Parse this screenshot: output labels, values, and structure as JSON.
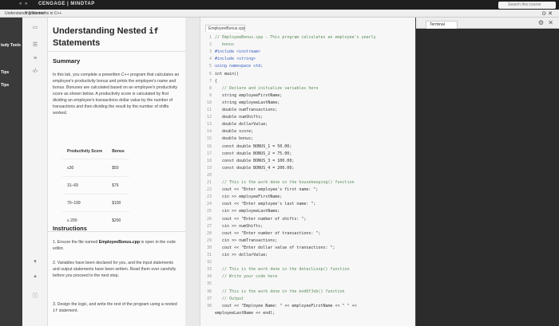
{
  "topbar": {
    "nav": "«  »",
    "brand": "CENGAGE | MINDTAP",
    "search": "Search this course"
  },
  "subbar": {
    "crumb": "Understanding Nested",
    "crumb2": "if Statements in C++"
  },
  "leftnav": [
    "tudy Tools",
    "Tips",
    "Tips"
  ],
  "lesson": {
    "title_prefix": "Understanding Nested ",
    "title_code": "if",
    "title_suffix": "Statements",
    "summary_heading": "Summary",
    "summary_text": "In this lab, you complete a prewritten C++ program that calculates an employee's productivity bonus and prints the employee's name and bonus. Bonuses are calculated based on an employee's productivity score as shown below. A productivity score is calculated by first dividing an employee's transactions dollar value by the number of transactions and then dividing the result by the number of shifts worked.",
    "table": {
      "headers": [
        "Productivity Score",
        "Bonus"
      ],
      "rows": [
        [
          "≤30",
          "$50"
        ],
        [
          "31–69",
          "$75"
        ],
        [
          "70–199",
          "$100"
        ],
        [
          "≥ 200",
          "$200"
        ]
      ]
    },
    "instructions_heading": "Instructions",
    "item1_prefix": "1. Ensure the file named ",
    "item1_bold": "EmployeeBonus.cpp",
    "item1_suffix": " is open in the code editor.",
    "item2": "2. Variables have been declared for you, and the input statements and output statements have been written. Read them over carefully before you proceed to the next step.",
    "item3_prefix": "3. Design the logic, and write the rest of the program using a nested ",
    "item3_code": "if",
    "item3_suffix": " statement."
  },
  "editor": {
    "tab": "EmployeeBonus.cpp",
    "lines": [
      {
        "n": "1",
        "t": "// EmployeeBonus.cpp - This program calculates an employee's yearly",
        "c": "cm"
      },
      {
        "n": "2",
        "t": "   bonus",
        "c": "cm"
      },
      {
        "n": "3",
        "t": "#include <iostream>",
        "c": "kw"
      },
      {
        "n": "4",
        "t": "#include <string>",
        "c": "kw"
      },
      {
        "n": "5",
        "t": "using namespace std;",
        "c": "kw"
      },
      {
        "n": "6",
        "t": "int main()",
        "c": ""
      },
      {
        "n": "7",
        "t": "{",
        "c": ""
      },
      {
        "n": "8",
        "t": "   // Declare and initialize variables here",
        "c": "cm"
      },
      {
        "n": "9",
        "t": "   string employeeFirstName;",
        "c": ""
      },
      {
        "n": "10",
        "t": "   string employeeLastName;",
        "c": ""
      },
      {
        "n": "11",
        "t": "   double numTransactions;",
        "c": ""
      },
      {
        "n": "12",
        "t": "   double numShifts;",
        "c": ""
      },
      {
        "n": "13",
        "t": "   double dollarValue;",
        "c": ""
      },
      {
        "n": "14",
        "t": "   double score;",
        "c": ""
      },
      {
        "n": "15",
        "t": "   double bonus;",
        "c": ""
      },
      {
        "n": "16",
        "t": "   const double BONUS_1 = 50.00;",
        "c": ""
      },
      {
        "n": "17",
        "t": "   const double BONUS_2 = 75.00;",
        "c": ""
      },
      {
        "n": "18",
        "t": "   const double BONUS_3 = 100.00;",
        "c": ""
      },
      {
        "n": "19",
        "t": "   const double BONUS_4 = 200.00;",
        "c": ""
      },
      {
        "n": "20",
        "t": "",
        "c": ""
      },
      {
        "n": "21",
        "t": "   // This is the work done in the housekeeping() function",
        "c": "cm"
      },
      {
        "n": "22",
        "t": "   cout << \"Enter employee's first name: \";",
        "c": ""
      },
      {
        "n": "23",
        "t": "   cin >> employeeFirstName;",
        "c": ""
      },
      {
        "n": "24",
        "t": "   cout << \"Enter employee's last name: \";",
        "c": ""
      },
      {
        "n": "25",
        "t": "   cin >> employeeLastName;",
        "c": ""
      },
      {
        "n": "26",
        "t": "   cout << \"Enter number of shifts: \";",
        "c": ""
      },
      {
        "n": "27",
        "t": "   cin >> numShifts;",
        "c": ""
      },
      {
        "n": "28",
        "t": "   cout << \"Enter number of transactions: \";",
        "c": ""
      },
      {
        "n": "29",
        "t": "   cin >> numTransactions;",
        "c": ""
      },
      {
        "n": "30",
        "t": "   cout << \"Enter dollar value of transactions: \";",
        "c": ""
      },
      {
        "n": "31",
        "t": "   cin >> dollarValue;",
        "c": ""
      },
      {
        "n": "32",
        "t": "",
        "c": ""
      },
      {
        "n": "33",
        "t": "   // This is the work done in the detailLoop() function",
        "c": "cm"
      },
      {
        "n": "34",
        "t": "   // Write your code here",
        "c": "cm"
      },
      {
        "n": "35",
        "t": "",
        "c": ""
      },
      {
        "n": "36",
        "t": "   // This is the work done in the endOfJob() function",
        "c": "cm"
      },
      {
        "n": "37",
        "t": "   // Output",
        "c": "cm"
      },
      {
        "n": "38",
        "t": "   cout << \"Employee Name: \" << employeeFirstName << \" \" <<",
        "c": ""
      },
      {
        "n": "",
        "t": "employeeLastName << endl;",
        "c": ""
      }
    ]
  },
  "terminal": {
    "tab": "Terminal",
    "gear": "⚙",
    "close": "✕"
  }
}
